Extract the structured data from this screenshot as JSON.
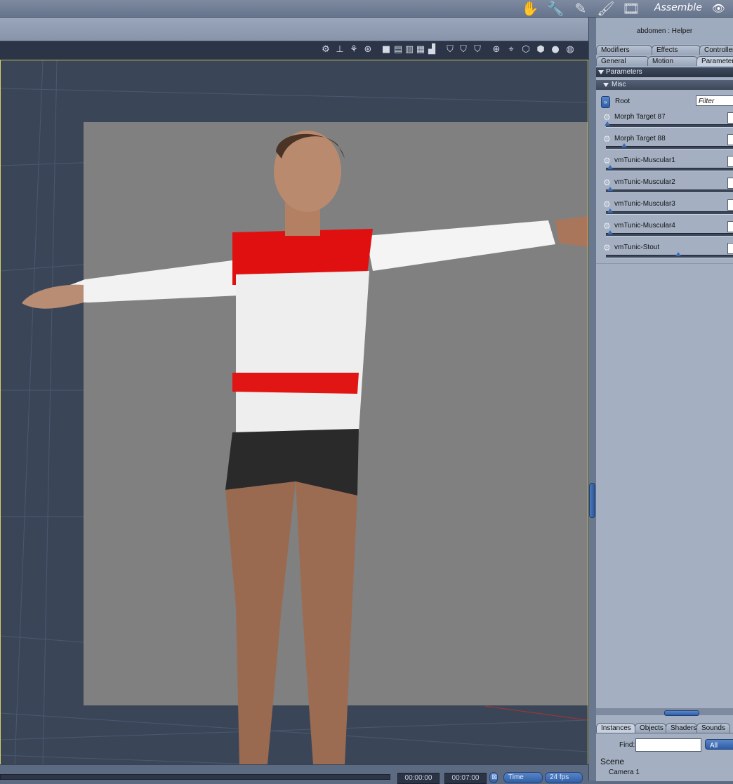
{
  "topbar": {
    "room_label": "Assemble",
    "room_icons": [
      "hand-icon",
      "wrench-icon",
      "pen-icon",
      "brush-icon",
      "film-icon"
    ],
    "right_icon": "eye-icon"
  },
  "viewport": {
    "toolbar_icons": [
      "node-icon",
      "marker-icon",
      "hierarchy-icon",
      "target-icon",
      "single-view-icon",
      "split-horizontal-icon",
      "split-vertical-icon",
      "quad-view-icon",
      "custom-view-icon",
      "bounding-shield-icon",
      "wire-shield-icon",
      "outline-shield-icon",
      "move-view-icon",
      "orbit-view-icon",
      "wireframe-cube-icon",
      "solid-cube-icon",
      "smooth-sphere-icon",
      "textured-sphere-icon"
    ],
    "border_color": "#d4cf6a",
    "background_color": "#3a4658"
  },
  "timeline": {
    "current_time": "00:00:00",
    "end_time": "00:07:00",
    "mode_label": "Time",
    "fps_label": "24 fps"
  },
  "panel": {
    "title": "abdomen : Helper",
    "tabs_row1": [
      "Modifiers",
      "Effects",
      "Controllers"
    ],
    "tabs_row2": [
      "General",
      "Motion",
      "Parameters"
    ],
    "section_parameters": "Parameters",
    "section_misc": "Misc",
    "root_label": "Root",
    "filter_placeholder": "Filter",
    "params": [
      {
        "label": "Morph Target 87",
        "value": 0.0
      },
      {
        "label": "Morph Target 88",
        "value": 0.17
      },
      {
        "label": "vmTunic-Muscular1",
        "value": 0.03
      },
      {
        "label": "vmTunic-Muscular2",
        "value": 0.03
      },
      {
        "label": "vmTunic-Muscular3",
        "value": 0.03
      },
      {
        "label": "vmTunic-Muscular4",
        "value": 0.03
      },
      {
        "label": "vmTunic-Stout",
        "value": 0.73
      }
    ],
    "bottom_tabs": [
      "Instances",
      "Objects",
      "Shaders",
      "Sounds"
    ],
    "find_label": "Find:",
    "find_value": "",
    "find_scope": "All",
    "scene_title": "Scene",
    "scene_items": [
      "Camera 1"
    ]
  }
}
